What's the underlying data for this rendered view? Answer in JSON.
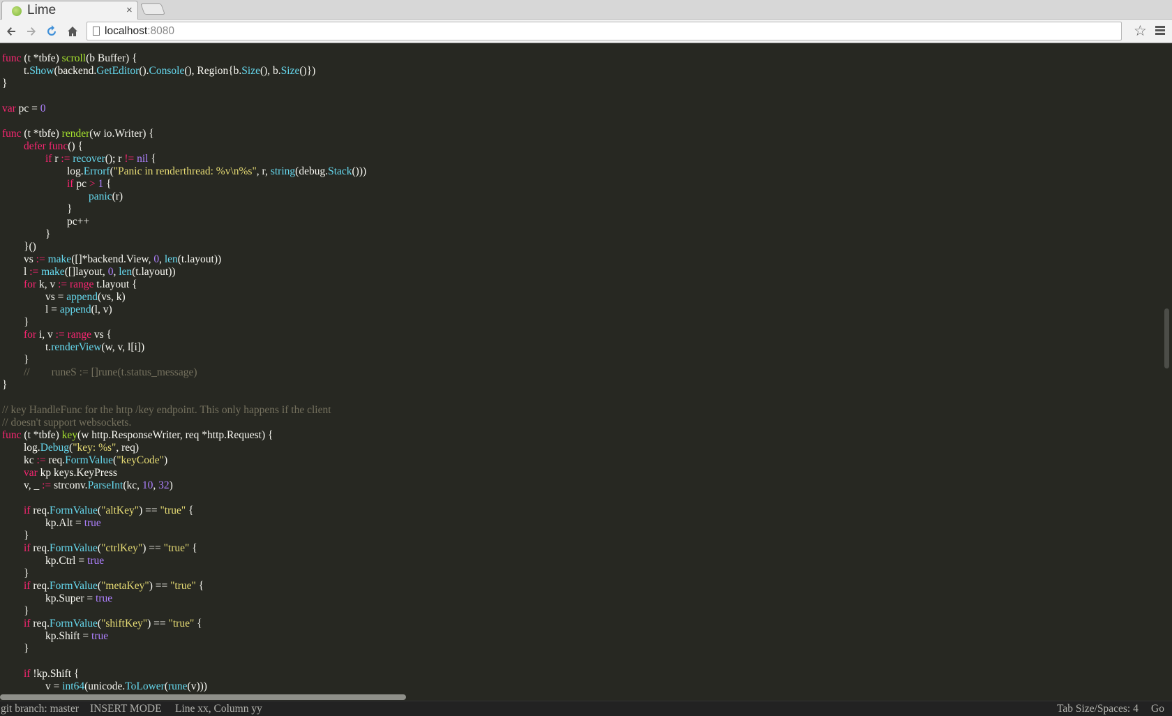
{
  "browser": {
    "tab_title": "Lime",
    "tab_close": "×",
    "url_host": "localhost",
    "url_port": ":8080"
  },
  "icons": {
    "back": "back-arrow-icon",
    "forward": "forward-arrow-icon",
    "reload": "reload-icon",
    "home": "home-icon",
    "page": "page-icon",
    "star": "bookmark-star-icon",
    "menu": "menu-icon"
  },
  "syntax_colors": {
    "background": "#272822",
    "text": "#f8f8f2",
    "keyword": "#f92672",
    "function_name": "#a6e22e",
    "call": "#66d9ef",
    "number": "#ae81ff",
    "string": "#e6db74",
    "comment": "#75715e"
  },
  "code": {
    "lines": [
      [
        [
          "k",
          "func"
        ],
        [
          "t",
          " (t *tbfe) "
        ],
        [
          "f",
          "scroll"
        ],
        [
          "t",
          "(b Buffer) {"
        ]
      ],
      [
        [
          "t",
          "\tt."
        ],
        [
          "c",
          "Show"
        ],
        [
          "t",
          "(backend."
        ],
        [
          "c",
          "GetEditor"
        ],
        [
          "t",
          "()."
        ],
        [
          "c",
          "Console"
        ],
        [
          "t",
          "(), Region{b."
        ],
        [
          "c",
          "Size"
        ],
        [
          "t",
          "(), b."
        ],
        [
          "c",
          "Size"
        ],
        [
          "t",
          "()})"
        ]
      ],
      [
        [
          "t",
          "}"
        ]
      ],
      [],
      [
        [
          "k",
          "var"
        ],
        [
          "t",
          " pc = "
        ],
        [
          "n",
          "0"
        ]
      ],
      [],
      [
        [
          "k",
          "func"
        ],
        [
          "t",
          " (t *tbfe) "
        ],
        [
          "f",
          "render"
        ],
        [
          "t",
          "(w io.Writer) {"
        ]
      ],
      [
        [
          "t",
          "\t"
        ],
        [
          "k",
          "defer func"
        ],
        [
          "t",
          "() {"
        ]
      ],
      [
        [
          "t",
          "\t\t"
        ],
        [
          "k",
          "if"
        ],
        [
          "t",
          " r "
        ],
        [
          "k",
          ":="
        ],
        [
          "t",
          " "
        ],
        [
          "c",
          "recover"
        ],
        [
          "t",
          "(); r "
        ],
        [
          "k",
          "!="
        ],
        [
          "t",
          " "
        ],
        [
          "n",
          "nil"
        ],
        [
          "t",
          " {"
        ]
      ],
      [
        [
          "t",
          "\t\t\tlog."
        ],
        [
          "c",
          "Errorf"
        ],
        [
          "t",
          "("
        ],
        [
          "s",
          "\"Panic in renderthread: %v\\n%s\""
        ],
        [
          "t",
          ", r, "
        ],
        [
          "c",
          "string"
        ],
        [
          "t",
          "(debug."
        ],
        [
          "c",
          "Stack"
        ],
        [
          "t",
          "()))"
        ]
      ],
      [
        [
          "t",
          "\t\t\t"
        ],
        [
          "k",
          "if"
        ],
        [
          "t",
          " pc "
        ],
        [
          "k",
          ">"
        ],
        [
          "t",
          " "
        ],
        [
          "n",
          "1"
        ],
        [
          "t",
          " {"
        ]
      ],
      [
        [
          "t",
          "\t\t\t\t"
        ],
        [
          "c",
          "panic"
        ],
        [
          "t",
          "(r)"
        ]
      ],
      [
        [
          "t",
          "\t\t\t}"
        ]
      ],
      [
        [
          "t",
          "\t\t\tpc++"
        ]
      ],
      [
        [
          "t",
          "\t\t}"
        ]
      ],
      [
        [
          "t",
          "\t}()"
        ]
      ],
      [
        [
          "t",
          "\tvs "
        ],
        [
          "k",
          ":="
        ],
        [
          "t",
          " "
        ],
        [
          "c",
          "make"
        ],
        [
          "t",
          "([]*backend.View, "
        ],
        [
          "n",
          "0"
        ],
        [
          "t",
          ", "
        ],
        [
          "c",
          "len"
        ],
        [
          "t",
          "(t.layout))"
        ]
      ],
      [
        [
          "t",
          "\tl "
        ],
        [
          "k",
          ":="
        ],
        [
          "t",
          " "
        ],
        [
          "c",
          "make"
        ],
        [
          "t",
          "([]layout, "
        ],
        [
          "n",
          "0"
        ],
        [
          "t",
          ", "
        ],
        [
          "c",
          "len"
        ],
        [
          "t",
          "(t.layout))"
        ]
      ],
      [
        [
          "t",
          "\t"
        ],
        [
          "k",
          "for"
        ],
        [
          "t",
          " k, v "
        ],
        [
          "k",
          ":= range"
        ],
        [
          "t",
          " t.layout {"
        ]
      ],
      [
        [
          "t",
          "\t\tvs = "
        ],
        [
          "c",
          "append"
        ],
        [
          "t",
          "(vs, k)"
        ]
      ],
      [
        [
          "t",
          "\t\tl = "
        ],
        [
          "c",
          "append"
        ],
        [
          "t",
          "(l, v)"
        ]
      ],
      [
        [
          "t",
          "\t}"
        ]
      ],
      [
        [
          "t",
          "\t"
        ],
        [
          "k",
          "for"
        ],
        [
          "t",
          " i, v "
        ],
        [
          "k",
          ":= range"
        ],
        [
          "t",
          " vs {"
        ]
      ],
      [
        [
          "t",
          "\t\tt."
        ],
        [
          "c",
          "renderView"
        ],
        [
          "t",
          "(w, v, l[i])"
        ]
      ],
      [
        [
          "t",
          "\t}"
        ]
      ],
      [
        [
          "t",
          "\t"
        ],
        [
          "m",
          "//\truneS := []rune(t.status_message)"
        ]
      ],
      [
        [
          "t",
          "}"
        ]
      ],
      [],
      [
        [
          "m",
          "// key HandleFunc for the http /key endpoint. This only happens if the client"
        ]
      ],
      [
        [
          "m",
          "// doesn't support websockets."
        ]
      ],
      [
        [
          "k",
          "func"
        ],
        [
          "t",
          " (t *tbfe) "
        ],
        [
          "f",
          "key"
        ],
        [
          "t",
          "(w http.ResponseWriter, req *http.Request) {"
        ]
      ],
      [
        [
          "t",
          "\tlog."
        ],
        [
          "c",
          "Debug"
        ],
        [
          "t",
          "("
        ],
        [
          "s",
          "\"key: %s\""
        ],
        [
          "t",
          ", req)"
        ]
      ],
      [
        [
          "t",
          "\tkc "
        ],
        [
          "k",
          ":="
        ],
        [
          "t",
          " req."
        ],
        [
          "c",
          "FormValue"
        ],
        [
          "t",
          "("
        ],
        [
          "s",
          "\"keyCode\""
        ],
        [
          "t",
          ")"
        ]
      ],
      [
        [
          "t",
          "\t"
        ],
        [
          "k",
          "var"
        ],
        [
          "t",
          " kp keys.KeyPress"
        ]
      ],
      [
        [
          "t",
          "\tv, _ "
        ],
        [
          "k",
          ":="
        ],
        [
          "t",
          " strconv."
        ],
        [
          "c",
          "ParseInt"
        ],
        [
          "t",
          "(kc, "
        ],
        [
          "n",
          "10"
        ],
        [
          "t",
          ", "
        ],
        [
          "n",
          "32"
        ],
        [
          "t",
          ")"
        ]
      ],
      [],
      [
        [
          "t",
          "\t"
        ],
        [
          "k",
          "if"
        ],
        [
          "t",
          " req."
        ],
        [
          "c",
          "FormValue"
        ],
        [
          "t",
          "("
        ],
        [
          "s",
          "\"altKey\""
        ],
        [
          "t",
          ") == "
        ],
        [
          "s",
          "\"true\""
        ],
        [
          "t",
          " {"
        ]
      ],
      [
        [
          "t",
          "\t\tkp.Alt = "
        ],
        [
          "n",
          "true"
        ]
      ],
      [
        [
          "t",
          "\t}"
        ]
      ],
      [
        [
          "t",
          "\t"
        ],
        [
          "k",
          "if"
        ],
        [
          "t",
          " req."
        ],
        [
          "c",
          "FormValue"
        ],
        [
          "t",
          "("
        ],
        [
          "s",
          "\"ctrlKey\""
        ],
        [
          "t",
          ") == "
        ],
        [
          "s",
          "\"true\""
        ],
        [
          "t",
          " {"
        ]
      ],
      [
        [
          "t",
          "\t\tkp.Ctrl = "
        ],
        [
          "n",
          "true"
        ]
      ],
      [
        [
          "t",
          "\t}"
        ]
      ],
      [
        [
          "t",
          "\t"
        ],
        [
          "k",
          "if"
        ],
        [
          "t",
          " req."
        ],
        [
          "c",
          "FormValue"
        ],
        [
          "t",
          "("
        ],
        [
          "s",
          "\"metaKey\""
        ],
        [
          "t",
          ") == "
        ],
        [
          "s",
          "\"true\""
        ],
        [
          "t",
          " {"
        ]
      ],
      [
        [
          "t",
          "\t\tkp.Super = "
        ],
        [
          "n",
          "true"
        ]
      ],
      [
        [
          "t",
          "\t}"
        ]
      ],
      [
        [
          "t",
          "\t"
        ],
        [
          "k",
          "if"
        ],
        [
          "t",
          " req."
        ],
        [
          "c",
          "FormValue"
        ],
        [
          "t",
          "("
        ],
        [
          "s",
          "\"shiftKey\""
        ],
        [
          "t",
          ") == "
        ],
        [
          "s",
          "\"true\""
        ],
        [
          "t",
          " {"
        ]
      ],
      [
        [
          "t",
          "\t\tkp.Shift = "
        ],
        [
          "n",
          "true"
        ]
      ],
      [
        [
          "t",
          "\t}"
        ]
      ],
      [],
      [
        [
          "t",
          "\t"
        ],
        [
          "k",
          "if"
        ],
        [
          "t",
          " !kp.Shift {"
        ]
      ],
      [
        [
          "t",
          "\t\tv = "
        ],
        [
          "c",
          "int64"
        ],
        [
          "t",
          "(unicode."
        ],
        [
          "c",
          "ToLower"
        ],
        [
          "t",
          "("
        ],
        [
          "c",
          "rune"
        ],
        [
          "t",
          "(v)))"
        ]
      ]
    ]
  },
  "statusbar": {
    "git_branch": "git branch: master",
    "mode": "INSERT MODE",
    "position": "Line xx, Column yy",
    "tab_size": "Tab Size/Spaces: 4",
    "syntax": "Go"
  }
}
